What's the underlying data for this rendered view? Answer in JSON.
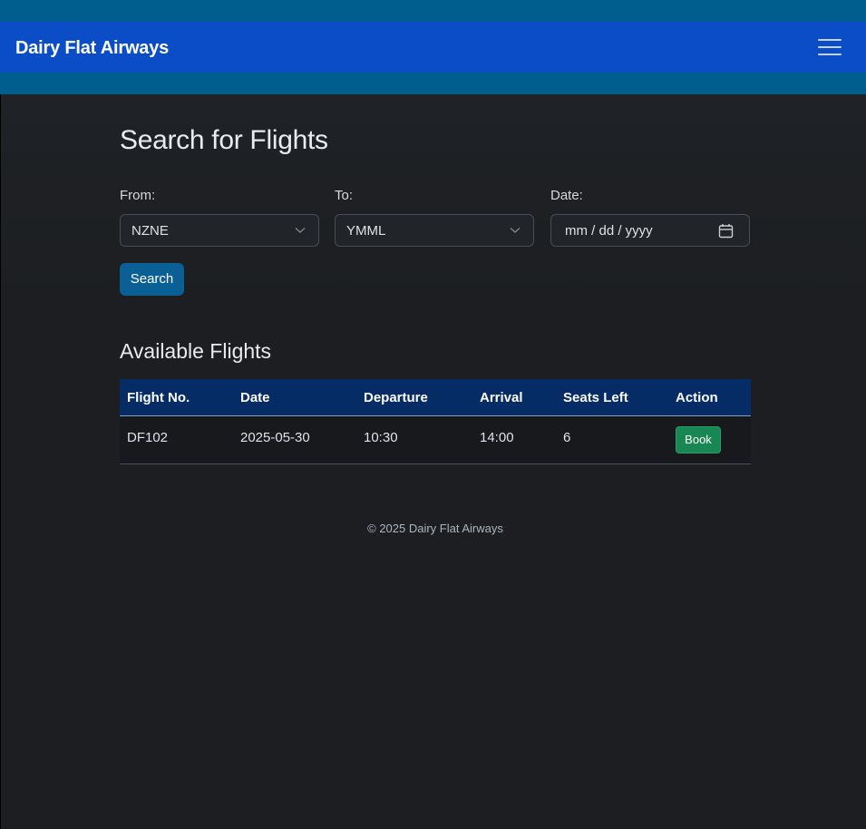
{
  "navbar": {
    "brand": "Dairy Flat Airways",
    "menu_icon": "hamburger-menu-icon"
  },
  "search": {
    "title": "Search for Flights",
    "from_label": "From:",
    "from_value": "NZNE",
    "to_label": "To:",
    "to_value": "YMML",
    "date_label": "Date:",
    "date_placeholder": "mm / dd / yyyy",
    "button_label": "Search"
  },
  "results": {
    "title": "Available Flights",
    "columns": [
      "Flight No.",
      "Date",
      "Departure",
      "Arrival",
      "Seats Left",
      "Action"
    ],
    "rows": [
      {
        "flight_no": "DF102",
        "date": "2025-05-30",
        "departure": "10:30",
        "arrival": "14:00",
        "seats_left": "6",
        "action": "Book"
      }
    ]
  },
  "footer": {
    "text": "© 2025 Dairy Flat Airways"
  },
  "colors": {
    "navbar_bg": "#0a4dc7",
    "header_band": "#005e8f",
    "page_bg": "#1c1e21",
    "table_header_bg": "#052c65",
    "search_button": "#0a5f95",
    "book_button": "#198754"
  }
}
